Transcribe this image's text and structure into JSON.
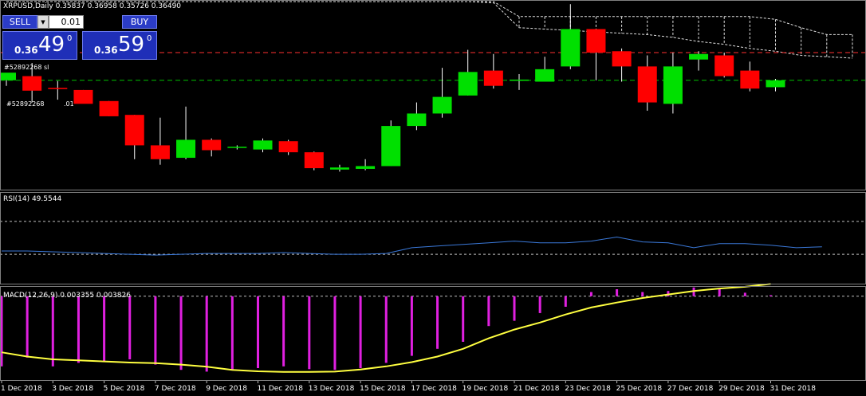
{
  "header": {
    "symbol_info": "XRPUSD,Daily  0.35837 0.36958 0.35726 0.36490"
  },
  "trade_panel": {
    "sell_label": "SELL",
    "buy_label": "BUY",
    "lot": "0.01",
    "spinner": "▼",
    "bid_small": "0.36",
    "bid_big": "49",
    "bid_sup": "0",
    "ask_small": "0.36",
    "ask_big": "59",
    "ask_sup": "0"
  },
  "order_tags": {
    "sl_tag": "#52892268 sl",
    "entry_tag_left": "#52892268",
    "entry_tag_right": ".01"
  },
  "rsi_label": "RSI(14) 49.5544",
  "macd_label": "MACD(12,26,9) 0.003355 0.003826",
  "colors": {
    "bull": "#00e000",
    "bear": "#ff0000",
    "rsi": "#3a78d8",
    "macd_hist": "#e020e0",
    "signal": "#ffff40",
    "sl_line": "#ff3030",
    "entry_line": "#00c000"
  },
  "chart_data": [
    {
      "type": "candlestick",
      "title": "XRPUSD,Daily",
      "x_tick_labels": [
        "1 Dec 2018",
        "3 Dec 2018",
        "5 Dec 2018",
        "7 Dec 2018",
        "9 Dec 2018",
        "11 Dec 2018",
        "13 Dec 2018",
        "15 Dec 2018",
        "17 Dec 2018",
        "19 Dec 2018",
        "21 Dec 2018",
        "23 Dec 2018",
        "25 Dec 2018",
        "27 Dec 2018",
        "29 Dec 2018",
        "31 Dec 2018"
      ],
      "ylim": [
        0.283,
        0.42
      ],
      "candles": [
        {
          "o": 0.362,
          "h": 0.367,
          "l": 0.358,
          "c": 0.3675
        },
        {
          "o": 0.365,
          "h": 0.3745,
          "l": 0.346,
          "c": 0.3545
        },
        {
          "o": 0.3565,
          "h": 0.3615,
          "l": 0.348,
          "c": 0.356
        },
        {
          "o": 0.355,
          "h": 0.355,
          "l": 0.346,
          "c": 0.345
        },
        {
          "o": 0.347,
          "h": 0.347,
          "l": 0.336,
          "c": 0.336
        },
        {
          "o": 0.337,
          "h": 0.337,
          "l": 0.305,
          "c": 0.315
        },
        {
          "o": 0.315,
          "h": 0.335,
          "l": 0.301,
          "c": 0.305
        },
        {
          "o": 0.306,
          "h": 0.343,
          "l": 0.305,
          "c": 0.319
        },
        {
          "o": 0.319,
          "h": 0.32,
          "l": 0.307,
          "c": 0.3115
        },
        {
          "o": 0.314,
          "h": 0.315,
          "l": 0.312,
          "c": 0.314
        },
        {
          "o": 0.312,
          "h": 0.32,
          "l": 0.31,
          "c": 0.3185
        },
        {
          "o": 0.318,
          "h": 0.319,
          "l": 0.308,
          "c": 0.31
        },
        {
          "o": 0.31,
          "h": 0.3105,
          "l": 0.297,
          "c": 0.2985
        },
        {
          "o": 0.2975,
          "h": 0.301,
          "l": 0.296,
          "c": 0.299
        },
        {
          "o": 0.298,
          "h": 0.305,
          "l": 0.297,
          "c": 0.3
        },
        {
          "o": 0.3,
          "h": 0.333,
          "l": 0.3,
          "c": 0.329
        },
        {
          "o": 0.329,
          "h": 0.346,
          "l": 0.326,
          "c": 0.338
        },
        {
          "o": 0.338,
          "h": 0.371,
          "l": 0.335,
          "c": 0.35
        },
        {
          "o": 0.351,
          "h": 0.384,
          "l": 0.351,
          "c": 0.368
        },
        {
          "o": 0.369,
          "h": 0.381,
          "l": 0.356,
          "c": 0.358
        },
        {
          "o": 0.362,
          "h": 0.3665,
          "l": 0.355,
          "c": 0.3625
        },
        {
          "o": 0.361,
          "h": 0.379,
          "l": 0.361,
          "c": 0.37
        },
        {
          "o": 0.372,
          "h": 0.417,
          "l": 0.37,
          "c": 0.399
        },
        {
          "o": 0.399,
          "h": 0.399,
          "l": 0.362,
          "c": 0.382
        },
        {
          "o": 0.383,
          "h": 0.385,
          "l": 0.361,
          "c": 0.372
        },
        {
          "o": 0.372,
          "h": 0.38,
          "l": 0.34,
          "c": 0.346
        },
        {
          "o": 0.345,
          "h": 0.382,
          "l": 0.338,
          "c": 0.372
        },
        {
          "o": 0.377,
          "h": 0.383,
          "l": 0.369,
          "c": 0.381
        },
        {
          "o": 0.38,
          "h": 0.382,
          "l": 0.364,
          "c": 0.365
        },
        {
          "o": 0.369,
          "h": 0.3755,
          "l": 0.354,
          "c": 0.356
        },
        {
          "o": 0.357,
          "h": 0.363,
          "l": 0.354,
          "c": 0.362
        }
      ],
      "ichimoku_cloud_upper": [
        0.45,
        0.45,
        0.45,
        0.45,
        0.45,
        0.45,
        0.45,
        0.45,
        0.45,
        0.45,
        0.45,
        0.45,
        0.45,
        0.45,
        0.45,
        0.45,
        0.45,
        0.445,
        0.44,
        0.422,
        0.408,
        0.408,
        0.408,
        0.408,
        0.408,
        0.408,
        0.408,
        0.408,
        0.408,
        0.408,
        0.406,
        0.4,
        0.395,
        0.395
      ],
      "ichimoku_cloud_lower": [
        0.45,
        0.45,
        0.45,
        0.45,
        0.45,
        0.45,
        0.45,
        0.45,
        0.45,
        0.45,
        0.45,
        0.45,
        0.45,
        0.45,
        0.45,
        0.45,
        0.45,
        0.444,
        0.436,
        0.418,
        0.4,
        0.399,
        0.398,
        0.397,
        0.396,
        0.395,
        0.393,
        0.39,
        0.388,
        0.385,
        0.383,
        0.38,
        0.379,
        0.378
      ],
      "sl_level": 0.382,
      "entry_level": 0.362
    },
    {
      "type": "line",
      "title": "RSI(14) 49.5544",
      "ylim": [
        0,
        100
      ],
      "levels": [
        70,
        30
      ],
      "values": [
        34,
        34,
        33,
        32,
        31,
        30,
        29,
        30,
        31,
        31,
        31,
        32,
        31,
        30,
        30,
        31,
        38,
        40,
        42,
        44,
        46,
        44,
        44,
        46,
        51,
        45,
        44,
        38,
        43,
        43,
        41,
        38,
        39
      ]
    },
    {
      "type": "bar",
      "title": "MACD(12,26,9) 0.003355 0.003826",
      "ylim": [
        -0.023,
        0.002
      ],
      "zero_level": 0,
      "histogram": [
        -0.02,
        -0.0175,
        -0.02,
        -0.019,
        -0.0185,
        -0.018,
        -0.0195,
        -0.021,
        -0.0215,
        -0.021,
        -0.0205,
        -0.02,
        -0.0208,
        -0.021,
        -0.0205,
        -0.019,
        -0.017,
        -0.015,
        -0.013,
        -0.0085,
        -0.007,
        -0.0048,
        -0.003,
        0.0012,
        0.002,
        0.0012,
        0.0015,
        0.0025,
        0.002,
        0.001,
        0.0003
      ],
      "signal": [
        -0.016,
        -0.0172,
        -0.018,
        -0.0183,
        -0.0186,
        -0.0189,
        -0.0191,
        -0.0195,
        -0.0201,
        -0.021,
        -0.0214,
        -0.0216,
        -0.0216,
        -0.0215,
        -0.0209,
        -0.02,
        -0.0188,
        -0.0172,
        -0.015,
        -0.012,
        -0.0095,
        -0.0075,
        -0.0052,
        -0.0032,
        -0.0018,
        -0.0005,
        0.0005,
        0.0015,
        0.0022,
        0.0027,
        0.0035
      ]
    }
  ]
}
